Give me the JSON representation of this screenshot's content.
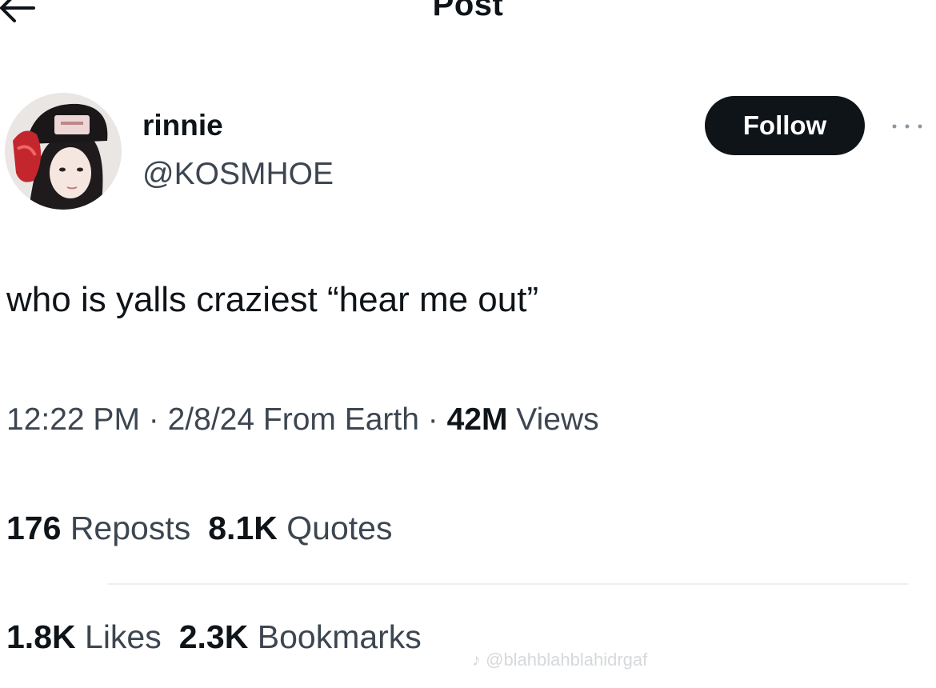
{
  "header": {
    "title": "Post",
    "back_icon": "arrow-left-icon"
  },
  "author": {
    "display_name": "rinnie",
    "handle": "@KOSMHOE",
    "follow_label": "Follow",
    "more_icon": "more-horizontal-icon"
  },
  "post": {
    "text": "who is yalls craziest “hear me out”"
  },
  "meta": {
    "time": "12:22 PM",
    "sep1": " · ",
    "date": "2/8/24",
    "source": " From Earth",
    "sep2": " · ",
    "views_count": "42M",
    "views_label": " Views"
  },
  "stats": {
    "reposts_count": "176",
    "reposts_label": "Reposts",
    "quotes_count": "8.1K",
    "quotes_label": "Quotes",
    "likes_count": "1.8K",
    "likes_label": "Likes",
    "bookmarks_count": "2.3K",
    "bookmarks_label": "Bookmarks"
  },
  "watermark": {
    "text": "♪ @blahblahblahidrgaf"
  },
  "colors": {
    "text_primary": "#0f1419",
    "text_secondary": "#3d4650",
    "follow_bg": "#0f1419",
    "follow_text": "#ffffff",
    "divider": "#eceef0"
  }
}
